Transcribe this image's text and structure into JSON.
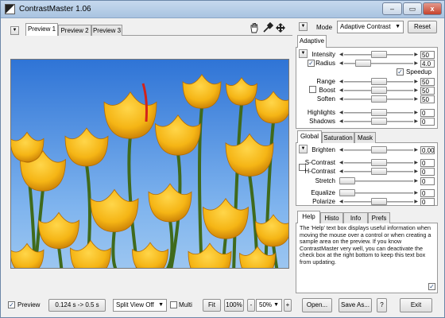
{
  "window": {
    "title": "ContrastMaster 1.06",
    "minimize_glyph": "–",
    "restore_glyph": "▭",
    "close_glyph": "x"
  },
  "preview_tabs": [
    "Preview 1",
    "Preview 2",
    "Preview 3"
  ],
  "toolbar_icons": [
    "hand-icon",
    "eyedropper-icon",
    "move-icon"
  ],
  "mode": {
    "label": "Mode",
    "value": "Adaptive Contrast",
    "reset": "Reset"
  },
  "adaptive": {
    "tab": "Adaptive",
    "rows": [
      {
        "label": "Intensity",
        "value": "50",
        "pos": 0.5
      },
      {
        "label": "Radius",
        "value": "4.0",
        "pos": 0.28,
        "checked": true
      }
    ],
    "speedup": "Speedup",
    "rows2": [
      {
        "label": "Range",
        "value": "50",
        "pos": 0.5
      },
      {
        "label": "Boost",
        "value": "50",
        "pos": 0.5
      },
      {
        "label": "Soften",
        "value": "50",
        "pos": 0.5
      }
    ],
    "rows3": [
      {
        "label": "Highlights",
        "value": "0",
        "pos": 0.5
      },
      {
        "label": "Shadows",
        "value": "0",
        "pos": 0.5
      }
    ]
  },
  "global_tabs": [
    "Global",
    "Saturation",
    "Mask"
  ],
  "global": {
    "rows": [
      {
        "label": "Brighten",
        "value": "0.00",
        "pos": 0.5
      },
      {
        "label": "S-Contrast",
        "value": "0",
        "pos": 0.5
      },
      {
        "label": "H-Contrast",
        "value": "0",
        "pos": 0.5
      },
      {
        "label": "Stretch",
        "value": "0",
        "pos": 0.05
      },
      {
        "label": "Equalize",
        "value": "0",
        "pos": 0.05
      },
      {
        "label": "Polarize",
        "value": "0",
        "pos": 0.5
      }
    ]
  },
  "help_tabs": [
    "Help",
    "Histo",
    "Info",
    "Prefs"
  ],
  "help_text": "The 'Help' text box displays useful information when moving the mouse over a control or when creating a sample area on the preview. If you know ContrastMaster very well, you can deactivate the check box at the right bottom to keep this text box from updating.",
  "bottom": {
    "preview": "Preview",
    "timing": "0.124 s -> 0.5 s",
    "split": "Split View Off",
    "multi": "Multi",
    "fit": "Fit",
    "zoom100": "100%",
    "zoom_minus": "-",
    "zoom": "50%",
    "zoom_plus": "+",
    "open": "Open...",
    "save": "Save As...",
    "help": "?",
    "exit": "Exit"
  }
}
